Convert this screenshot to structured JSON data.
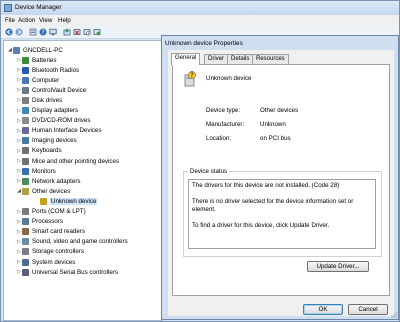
{
  "device_manager": {
    "title": "Device Manager",
    "menu": [
      "File",
      "Action",
      "View",
      "Help"
    ],
    "toolbar_icons": [
      "back-icon",
      "forward-icon",
      "properties-icon",
      "help-icon",
      "scan-icon",
      "update-driver-icon",
      "uninstall-icon",
      "disable-icon",
      "enable-icon"
    ],
    "tree": {
      "root": "GNCDELL-PC",
      "items": [
        {
          "label": "Batteries",
          "expanded": false,
          "icon_color": "#3a8a3a"
        },
        {
          "label": "Bluetooth Radios",
          "expanded": false,
          "icon_color": "#2a5ab0"
        },
        {
          "label": "Computer",
          "expanded": false,
          "icon_color": "#4a78b4"
        },
        {
          "label": "ControlVault Device",
          "expanded": false,
          "icon_color": "#6a7a8a"
        },
        {
          "label": "Disk drives",
          "expanded": false,
          "icon_color": "#7d7d7d"
        },
        {
          "label": "Display adapters",
          "expanded": false,
          "icon_color": "#3c8ab8"
        },
        {
          "label": "DVD/CD-ROM drives",
          "expanded": false,
          "icon_color": "#8a8a8a"
        },
        {
          "label": "Human Interface Devices",
          "expanded": false,
          "icon_color": "#6a6a9a"
        },
        {
          "label": "Imaging devices",
          "expanded": false,
          "icon_color": "#4a7aa0"
        },
        {
          "label": "Keyboards",
          "expanded": false,
          "icon_color": "#707070"
        },
        {
          "label": "Mice and other pointing devices",
          "expanded": false,
          "icon_color": "#707070"
        },
        {
          "label": "Monitors",
          "expanded": false,
          "icon_color": "#3a6eb0"
        },
        {
          "label": "Network adapters",
          "expanded": false,
          "icon_color": "#4a8a5a"
        },
        {
          "label": "Other devices",
          "expanded": true,
          "icon_color": "#b0a040"
        },
        {
          "label": "Unknown device",
          "child": true,
          "selected": true,
          "icon_color": "#c8a020"
        },
        {
          "label": "Ports (COM & LPT)",
          "expanded": false,
          "icon_color": "#7a7a7a"
        },
        {
          "label": "Processors",
          "expanded": false,
          "icon_color": "#5a7a9a"
        },
        {
          "label": "Smart card readers",
          "expanded": false,
          "icon_color": "#8a6a4a"
        },
        {
          "label": "Sound, video and game controllers",
          "expanded": false,
          "icon_color": "#6a8aaa"
        },
        {
          "label": "Storage controllers",
          "expanded": false,
          "icon_color": "#7a7a8a"
        },
        {
          "label": "System devices",
          "expanded": false,
          "icon_color": "#4a6a9a"
        },
        {
          "label": "Universal Serial Bus controllers",
          "expanded": false,
          "icon_color": "#5a5a7a"
        }
      ]
    }
  },
  "dialog": {
    "title": "Unknown device Properties",
    "tabs": [
      "General",
      "Driver",
      "Details",
      "Resources"
    ],
    "active_tab": "General",
    "device_name": "Unknown device",
    "properties": [
      {
        "label": "Device type:",
        "value": "Other devices"
      },
      {
        "label": "Manufacturer:",
        "value": "Unknown"
      },
      {
        "label": "Location:",
        "value": "on PCI bus"
      }
    ],
    "status_legend": "Device status",
    "status_lines": [
      "The drivers for this device are not installed. (Code 28)",
      "",
      "There is no driver selected for the device information set or element.",
      "",
      "To find a driver for this device, click Update Driver."
    ],
    "update_driver_label": "Update Driver...",
    "ok_label": "OK",
    "cancel_label": "Cancel"
  }
}
